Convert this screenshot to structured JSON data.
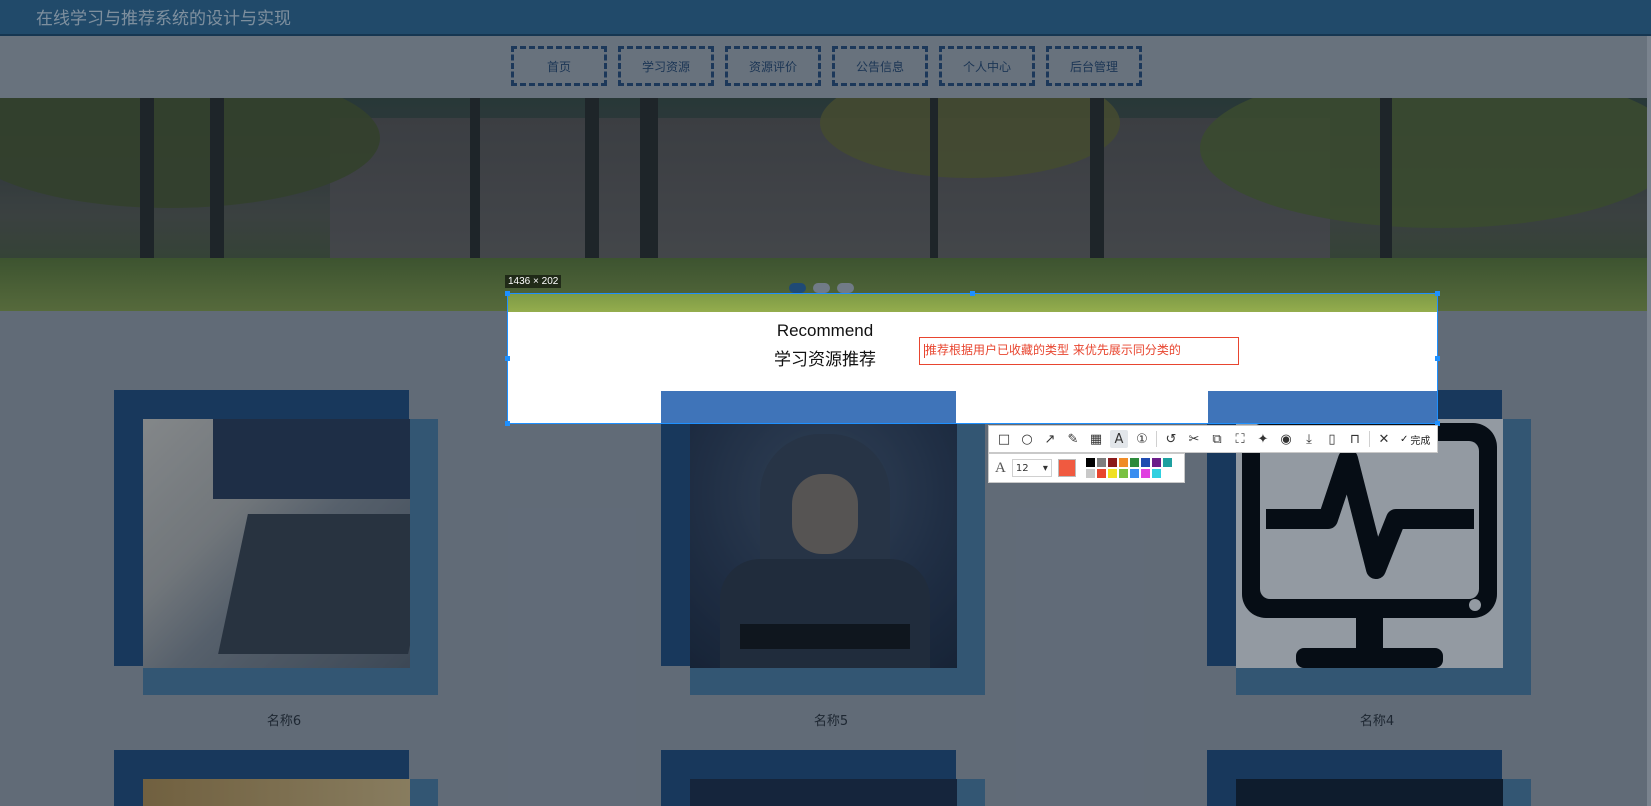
{
  "site": {
    "title": "在线学习与推荐系统的设计与实现"
  },
  "nav": [
    {
      "label": "首页"
    },
    {
      "label": "学习资源"
    },
    {
      "label": "资源评价"
    },
    {
      "label": "公告信息"
    },
    {
      "label": "个人中心"
    },
    {
      "label": "后台管理"
    }
  ],
  "carousel": {
    "slides": 3,
    "active_index": 0
  },
  "recommend": {
    "title_en": "Recommend",
    "title_cn": "学习资源推荐"
  },
  "cards": [
    {
      "name": "名称6",
      "image": "laptop-photo"
    },
    {
      "name": "名称5",
      "image": "hacker-photo"
    },
    {
      "name": "名称4",
      "image": "monitor-pulse-icon"
    }
  ],
  "screenshot_tool": {
    "size_label": "1436 × 202",
    "annotation_text": "推荐根据用户已收藏的类型 来优先展示同分类的",
    "font_size": "12",
    "current_color": "#f05a40",
    "done_label": "完成",
    "tools": [
      "rectangle-icon",
      "ellipse-icon",
      "arrow-icon",
      "pen-icon",
      "mosaic-icon",
      "text-icon",
      "number-icon",
      "undo-icon",
      "cut-icon",
      "translate-icon",
      "ocr-icon",
      "pin-icon",
      "record-icon",
      "download-icon",
      "long-screenshot-icon",
      "bookmark-icon"
    ],
    "palette": [
      "#000000",
      "#7f7f7f",
      "#8b1a1a",
      "#f08c28",
      "#2e8b3c",
      "#1f4bb0",
      "#6b1e8a",
      "#1ea0a0",
      "#ffffff",
      "#c8c8c8",
      "#e8452f",
      "#f0e020",
      "#7ac142",
      "#3a8ef0",
      "#e040e0",
      "#30d0e0"
    ]
  }
}
